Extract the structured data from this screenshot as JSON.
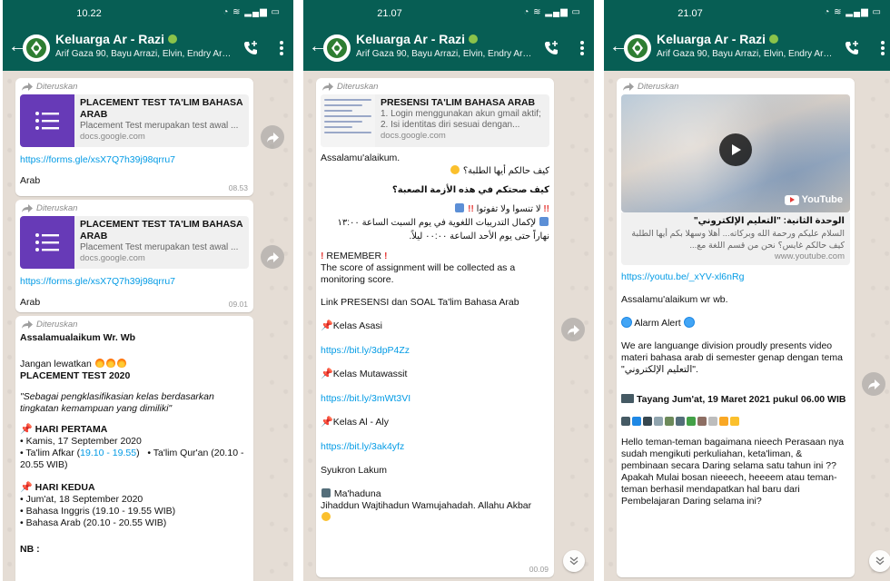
{
  "header": {
    "title": "Keluarga Ar - Razi",
    "subtitle": "Arif Gaza 90, Bayu Arrazi, Elvin, Endry Ar-Razi"
  },
  "screens": [
    {
      "status_time": "10.22",
      "messages": {
        "m1": {
          "forwarded": "Diteruskan",
          "card_title": "PLACEMENT TEST TA'LIM BAHASA ARAB",
          "card_desc": "Placement Test merupakan test awal ...",
          "card_host": "docs.google.com",
          "link": "https://forms.gle/xsX7Q7h39j98qrru7",
          "text": "Arab",
          "time": "08.53"
        },
        "m2": {
          "forwarded": "Diteruskan",
          "card_title": "PLACEMENT TEST TA'LIM BAHASA ARAB",
          "card_desc": "Placement Test merupakan test awal ...",
          "card_host": "docs.google.com",
          "link": "https://forms.gle/xsX7Q7h39j98qrru7",
          "text": "Arab",
          "time": "09.01"
        },
        "m3": {
          "forwarded": "Diteruskan",
          "greeting": "Assalamualaikum Wr. Wb",
          "dont_miss": "Jangan lewatkan",
          "heading": "PLACEMENT TEST 2020",
          "quote": "\"Sebagai pengklasifikasian kelas berdasarkan tingkatan kemampuan yang dimiliki\"",
          "day1_title": "HARI PERTAMA",
          "day1_date": "• Kamis, 17 September 2020",
          "day1_a_prefix": "• Ta'lim Afkar (",
          "day1_a_time": "19.10 - 19.55",
          "day1_a_suffix": ")",
          "day1_b": "• Ta'lim Qur'an (20.10 - 20.55 WIB)",
          "day2_title": "HARI KEDUA",
          "day2_date": "• Jum'at, 18 September 2020",
          "day2_a": "• Bahasa Inggris (19.10 - 19.55 WIB)",
          "day2_b": "• Bahasa Arab (20.10 - 20.55 WIB)",
          "nb": "NB :"
        }
      }
    },
    {
      "status_time": "21.07",
      "message": {
        "forwarded": "Diteruskan",
        "card_title": "PRESENSI TA'LIM BAHASA ARAB",
        "card_desc": "1. Login menggunakan akun gmail aktif; 2. Isi identitas diri sesuai dengan...",
        "card_host": "docs.google.com",
        "greeting": "Assalamu'alaikum.",
        "ar1": "كيف حالكم أيها الطلبة؟",
        "ar2": "كيف صحتكم في هذه الأزمة الصعبة؟",
        "ar3": "لا تنسوا ولا تفوتوا",
        "ar4": "لإكمال التدريبات اللغوية في يوم السبت الساعة ١٣:٠٠ نهاراً حتى يوم الأحد الساعة ٠٠:٠٠ ليلاً.",
        "remember": "REMEMBER",
        "remember_text": "The score of assignment will be collected as a monitoring score.",
        "link_intro": "Link PRESENSI dan SOAL Ta'lim Bahasa Arab",
        "class1": "Kelas Asasi",
        "class1_link": "https://bit.ly/3dpP4Zz",
        "class2": "Kelas Mutawassit",
        "class2_link": "https://bit.ly/3mWt3VI",
        "class3": "Kelas Al - Aly",
        "class3_link": "https://bit.ly/3ak4yfz",
        "thanks": "Syukron Lakum",
        "signoff_title": "Ma'haduna",
        "signoff": "Jihaddun Wajtihadun Wamujahadah. Allahu Akbar",
        "time": "00.09"
      }
    },
    {
      "status_time": "21.07",
      "message": {
        "forwarded": "Diteruskan",
        "yt_label": "YouTube",
        "card_title": "الوحدة الثانية: \"التعليم الإلكتروني\"",
        "card_desc": "السلام عليكم ورحمة الله وبركاته... أهلا وسهلا بكم أيها الطلبة كيف حالكم غايس؟ نحن من قسم اللغة مع...",
        "card_host": "www.youtube.com",
        "link": "https://youtu.be/_xYV-xl6nRg",
        "greeting": "Assalamu'alaikum wr wb.",
        "alarm": "Alarm Alert",
        "body": "We are languange division proudly presents video materi bahasa arab di semester genap dengan tema \"التعليم الإلكتروني\".",
        "airing": "Tayang Jum'at, 19 Maret 2021 pukul 06.00 WIB",
        "para": "Hello teman-teman bagaimana nieech Perasaan nya sudah mengikuti perkuliahan, keta'liman, & pembinaan secara Daring selama satu tahun ini ?? Apakah Mulai bosan nieeech, heeeem atau teman-teman berhasil mendapatkan hal baru dari Pembelajaran Daring selama ini?"
      }
    }
  ],
  "icons": {
    "back": "arrow-left-icon",
    "call": "add-call-icon",
    "menu": "more-vertical-icon",
    "forward": "forward-arrow-icon",
    "share": "share-forward-icon",
    "scroll": "chevron-double-down-icon"
  },
  "colors": {
    "header": "#075e54",
    "chat_bg": "#e5ddd5",
    "link": "#039be5",
    "google_forms": "#673ab7"
  }
}
